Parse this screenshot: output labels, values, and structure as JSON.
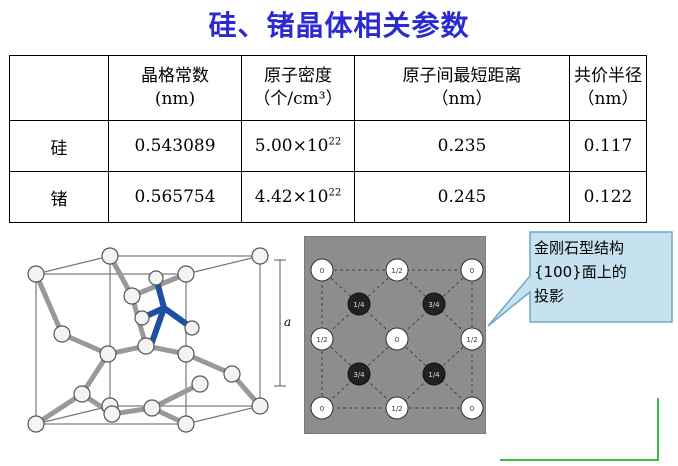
{
  "title": "硅、锗晶体相关参数",
  "table": {
    "headers": [
      {
        "line1": "",
        "line2": ""
      },
      {
        "line1": "晶格常数",
        "line2": "(nm)"
      },
      {
        "line1": "原子密度",
        "line2": "（个/cm³）"
      },
      {
        "line1": "原子间最短距离",
        "line2": "（nm）"
      },
      {
        "line1": "共价半径",
        "line2": "（nm）"
      }
    ],
    "rows": [
      {
        "element": "硅",
        "lattice": "0.543089",
        "density_base": "5.00×10",
        "density_exp": "22",
        "distance": "0.235",
        "radius": "0.117"
      },
      {
        "element": "锗",
        "lattice": "0.565754",
        "density_base": "4.42×10",
        "density_exp": "22",
        "distance": "0.245",
        "radius": "0.122"
      }
    ]
  },
  "figure": {
    "axis_label": "a",
    "projection_labels": {
      "zero": "0",
      "half": "1/2",
      "quarter": "1/4",
      "three_quarter": "3/4"
    }
  },
  "callout": {
    "line1": "金刚石型结构",
    "line2": "{100}面上的",
    "line3": "投影",
    "fill": "#c6e2ef",
    "border": "#6fa8c6"
  },
  "colors": {
    "title": "#2a2ad0",
    "bond_highlight": "#1f4fa0",
    "green_line": "#3bbf3b"
  }
}
